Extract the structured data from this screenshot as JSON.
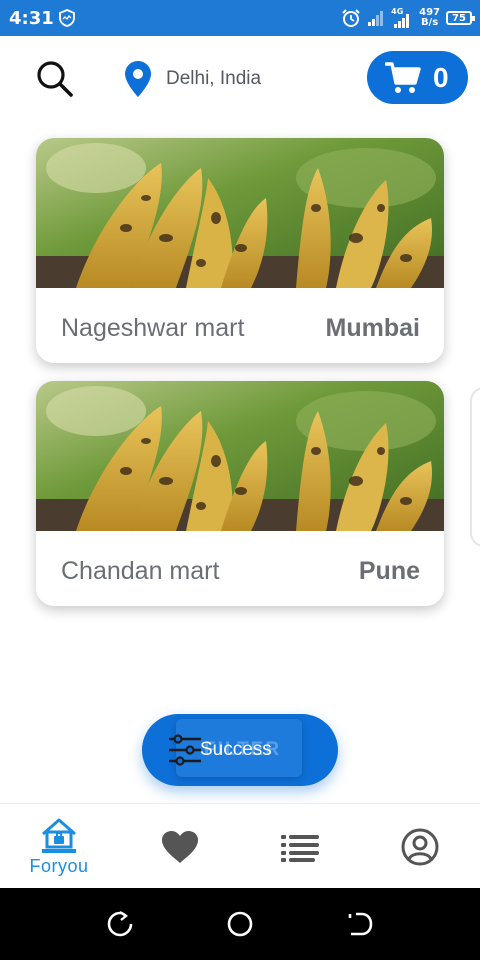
{
  "status_bar": {
    "time": "4:31",
    "network_type": "4G",
    "speed_value": "497",
    "speed_unit": "B/s",
    "battery": "75",
    "color": "#1f7ad6"
  },
  "header": {
    "search_icon": "search-icon",
    "location_icon": "location-pin-icon",
    "location": "Delhi, India",
    "cart_icon": "cart-icon",
    "cart_count": "0",
    "accent": "#0d70d8"
  },
  "stores": [
    {
      "name": "Nageshwar mart",
      "city": "Mumbai",
      "image": "roasted-banana-photo"
    },
    {
      "name": "Chandan mart",
      "city": "Pune",
      "image": "roasted-banana-photo"
    }
  ],
  "fab": {
    "label": "Success",
    "underlying_label": "FILTER",
    "icon": "filter-sliders-icon"
  },
  "bottom_nav": {
    "items": [
      {
        "label": "Foryou",
        "icon": "home-icon",
        "active": true
      },
      {
        "label": "",
        "icon": "heart-icon",
        "active": false
      },
      {
        "label": "",
        "icon": "list-icon",
        "active": false
      },
      {
        "label": "",
        "icon": "profile-icon",
        "active": false
      }
    ],
    "active_color": "#1a8ee0",
    "inactive_color": "#555555"
  },
  "system_nav": {
    "buttons": [
      "recents-icon",
      "home-circle-icon",
      "back-icon"
    ]
  }
}
